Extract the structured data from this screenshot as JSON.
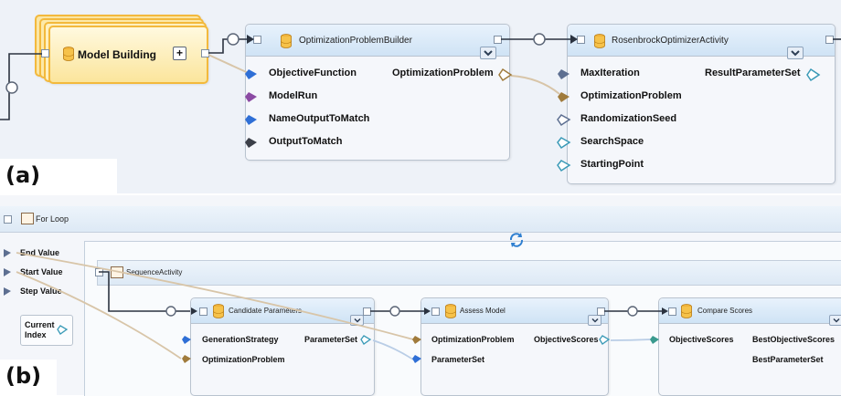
{
  "panel_a": {
    "letter": "(a)",
    "model_building": {
      "label": "Model Building",
      "expand_glyph": "+"
    },
    "builder": {
      "title": "OptimizationProblemBuilder",
      "inputs": [
        "ObjectiveFunction",
        "ModelRun",
        "NameOutputToMatch",
        "OutputToMatch"
      ],
      "output": "OptimizationProblem"
    },
    "optimizer": {
      "title": "RosenbrockOptimizerActivity",
      "inputs": [
        "MaxIteration",
        "OptimizationProblem",
        "RandomizationSeed",
        "SearchSpace",
        "StartingPoint"
      ],
      "output": "ResultParameterSet"
    }
  },
  "panel_b": {
    "letter": "(b)",
    "for_loop": {
      "title": "For Loop"
    },
    "loop_args": [
      "End Value",
      "Start Value",
      "Step Value"
    ],
    "current_index": {
      "line1": "Current",
      "line2": "Index"
    },
    "sequence": {
      "title": "SequenceActivity"
    },
    "candidate": {
      "title": "Candidate Parameters",
      "inputs": [
        "GenerationStrategy",
        "OptimizationProblem"
      ],
      "output": "ParameterSet"
    },
    "assess": {
      "title": "Assess Model",
      "inputs": [
        "OptimizationProblem",
        "ParameterSet"
      ],
      "output": "ObjectiveScores"
    },
    "compare": {
      "title": "Compare Scores",
      "inputs": [
        "ObjectiveScores"
      ],
      "outputs": [
        "BestObjectiveScores",
        "BestParameterSet"
      ]
    }
  },
  "colors": {
    "port_blue": "#2f6fd6",
    "port_purple": "#8b4aa3",
    "port_dark": "#3b3f48",
    "port_gray_blue": "#5d6f91",
    "port_brown": "#a07b3c",
    "port_teal": "#3a9a8e",
    "wire": "#2b3340",
    "wire_tan": "#d8c5a8",
    "selection": "#f3b93c"
  }
}
